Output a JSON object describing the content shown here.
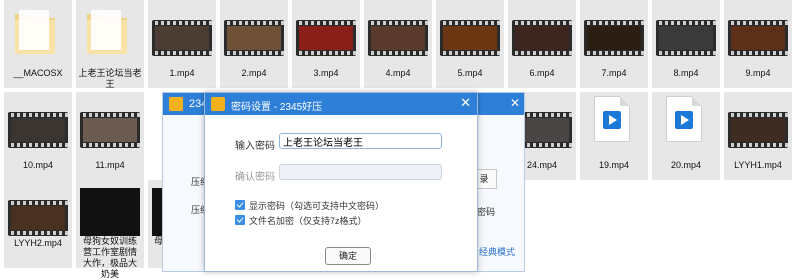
{
  "files": [
    {
      "name": "__MACOSX",
      "kind": "folder"
    },
    {
      "name": "上老王论坛当老王",
      "kind": "folder"
    },
    {
      "name": "1.mp4",
      "kind": "video",
      "color": "#4b3d33"
    },
    {
      "name": "2.mp4",
      "kind": "video",
      "color": "#6e5036"
    },
    {
      "name": "3.mp4",
      "kind": "video",
      "color": "#8a1f18"
    },
    {
      "name": "4.mp4",
      "kind": "video",
      "color": "#5a3a2c"
    },
    {
      "name": "5.mp4",
      "kind": "video",
      "color": "#6b3612"
    },
    {
      "name": "6.mp4",
      "kind": "video",
      "color": "#3d2520"
    },
    {
      "name": "7.mp4",
      "kind": "video",
      "color": "#2a1f12"
    },
    {
      "name": "8.mp4",
      "kind": "video",
      "color": "#3a3a3a"
    },
    {
      "name": "9.mp4",
      "kind": "video",
      "color": "#5b2f18"
    },
    {
      "name": "10.mp4",
      "kind": "video",
      "color": "#3a3530"
    },
    {
      "name": "11.mp4",
      "kind": "video",
      "color": "#6a5a50"
    },
    {
      "name": "24.mp4",
      "kind": "video",
      "color": "#4a4545"
    },
    {
      "name": "19.mp4",
      "kind": "media"
    },
    {
      "name": "20.mp4",
      "kind": "media"
    },
    {
      "name": "LYYH1.mp4",
      "kind": "video",
      "color": "#3e2b22"
    },
    {
      "name": "LYYH2.mp4",
      "kind": "video",
      "color": "#4a3020"
    },
    {
      "name": "母狗女奴训练营工作室剧情大作，极品大奶美",
      "kind": "text"
    },
    {
      "name": "母",
      "kind": "text"
    }
  ],
  "bg_window": {
    "title": "2345",
    "compress_label": "压缩",
    "compress_label2": "压缩",
    "side_button": "录",
    "side_text": "密码",
    "link": "经典模式"
  },
  "dialog": {
    "title": "密码设置 - 2345好压",
    "close_icon": "close-icon",
    "password_label": "输入密码",
    "password_value": "上老王论坛当老王",
    "confirm_label": "确认密码",
    "confirm_value": "",
    "show_password_label": "显示密码（勾选可支持中文密码）",
    "encrypt_names_label": "文件名加密（仅支持7z格式）",
    "show_password_checked": true,
    "encrypt_names_checked": true,
    "ok_button": "确定",
    "accent": "#2e7fd8"
  }
}
